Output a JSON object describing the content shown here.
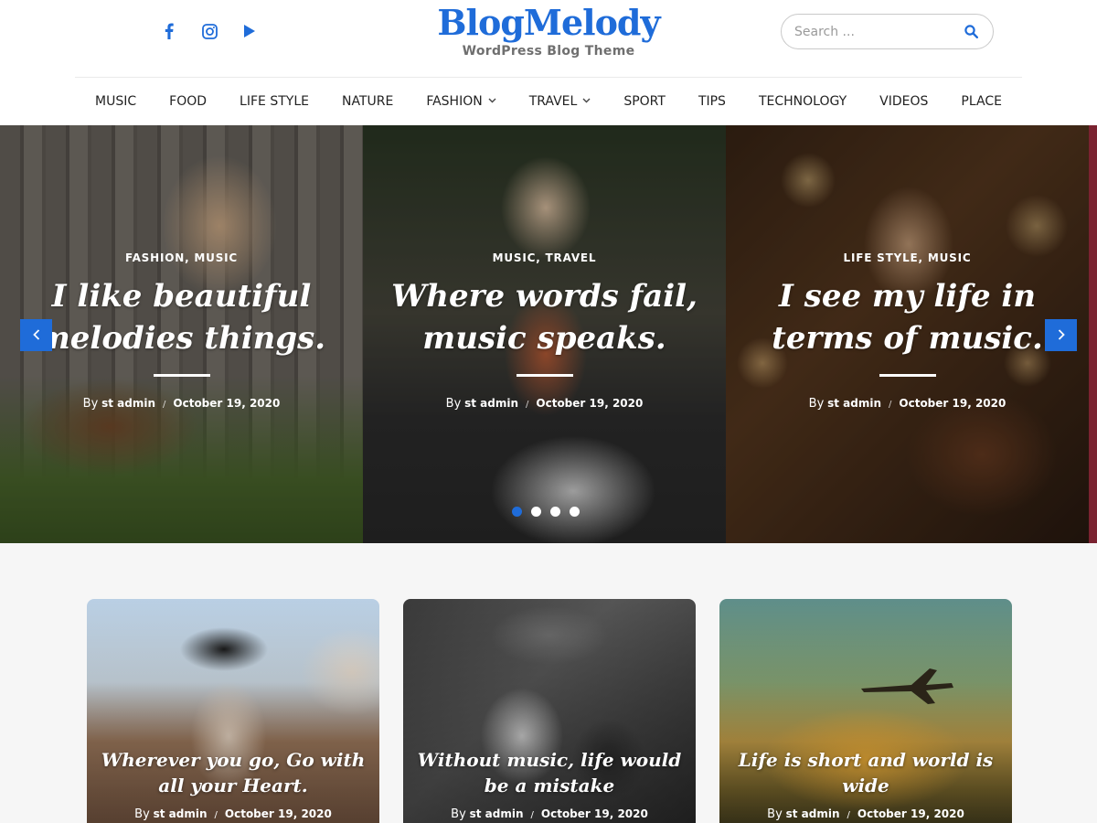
{
  "header": {
    "logo_title": "BlogMelody",
    "logo_tagline": "WordPress Blog Theme",
    "social_icons": [
      "facebook-icon",
      "instagram-icon",
      "youtube-play-icon"
    ],
    "search": {
      "placeholder": "Search ..."
    },
    "accent_color": "#1f6cd9"
  },
  "nav": {
    "items": [
      {
        "label": "MUSIC",
        "has_dropdown": false
      },
      {
        "label": "FOOD",
        "has_dropdown": false
      },
      {
        "label": "LIFE STYLE",
        "has_dropdown": false
      },
      {
        "label": "NATURE",
        "has_dropdown": false
      },
      {
        "label": "FASHION",
        "has_dropdown": true
      },
      {
        "label": "TRAVEL",
        "has_dropdown": true
      },
      {
        "label": "SPORT",
        "has_dropdown": false
      },
      {
        "label": "TIPS",
        "has_dropdown": false
      },
      {
        "label": "TECHNOLOGY",
        "has_dropdown": false
      },
      {
        "label": "VIDEOS",
        "has_dropdown": false
      },
      {
        "label": "PLACE",
        "has_dropdown": false
      }
    ]
  },
  "slider": {
    "slides": [
      {
        "categories": "FASHION, MUSIC",
        "title": "I like beautiful melodies things.",
        "by": "By",
        "author": "st admin",
        "date": "October 19, 2020"
      },
      {
        "categories": "MUSIC, TRAVEL",
        "title": "Where words fail, music speaks.",
        "by": "By",
        "author": "st admin",
        "date": "October 19, 2020"
      },
      {
        "categories": "LIFE STYLE, MUSIC",
        "title": "I see my life in terms of music.",
        "by": "By",
        "author": "st admin",
        "date": "October 19, 2020"
      }
    ],
    "dots_count": 4,
    "active_dot": 1,
    "prev_icon": "chevron-left-icon",
    "next_icon": "chevron-right-icon"
  },
  "posts": [
    {
      "title": "Wherever you go, Go with all your Heart.",
      "by": "By",
      "author": "st admin",
      "date": "October 19, 2020"
    },
    {
      "title": "Without music, life would be a mistake",
      "by": "By",
      "author": "st admin",
      "date": "October 19, 2020"
    },
    {
      "title": "Life is short and world is wide",
      "by": "By",
      "author": "st admin",
      "date": "October 19, 2020"
    }
  ]
}
